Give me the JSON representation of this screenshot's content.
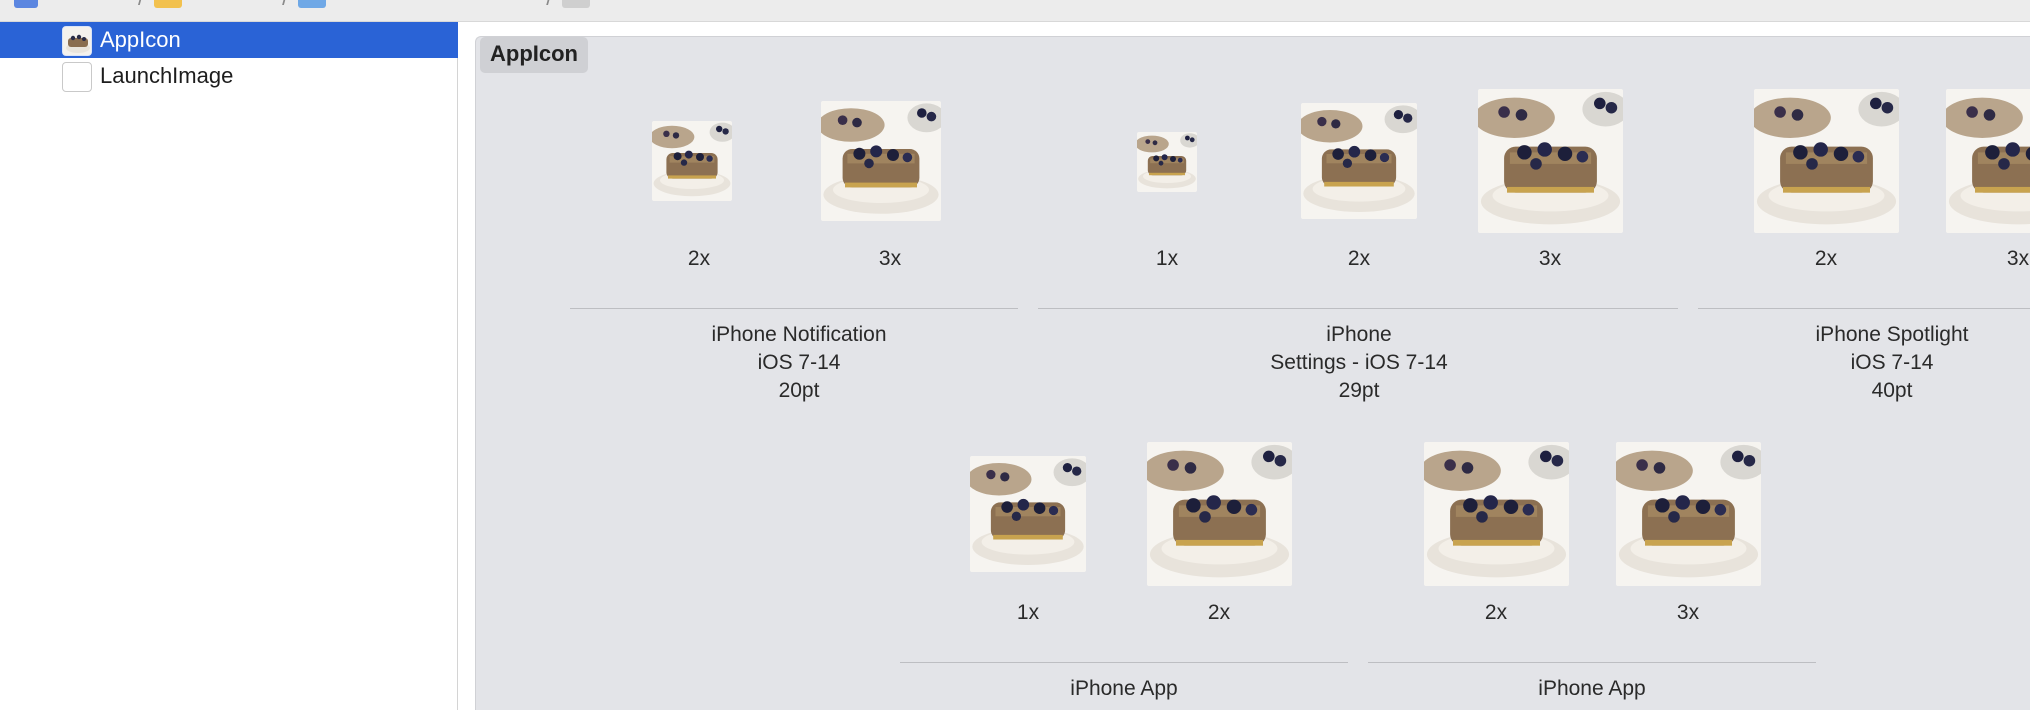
{
  "sidebar": {
    "items": [
      {
        "label": "AppIcon",
        "selected": true
      },
      {
        "label": "LaunchImage",
        "selected": false
      }
    ]
  },
  "editor": {
    "set_title": "AppIcon",
    "groups": [
      {
        "slots": [
          "2x",
          "3x"
        ],
        "lines": [
          "iPhone Notification",
          "iOS 7-14",
          "20pt"
        ]
      },
      {
        "slots": [
          "1x",
          "2x",
          "3x"
        ],
        "lines": [
          "iPhone",
          "Settings - iOS 7-14",
          "29pt"
        ]
      },
      {
        "slots": [
          "2x",
          "3x"
        ],
        "lines": [
          "iPhone Spotlight",
          "iOS 7-14",
          "40pt"
        ]
      },
      {
        "slots": [
          "1x",
          "2x"
        ],
        "lines": [
          "iPhone App"
        ]
      },
      {
        "slots": [
          "2x",
          "3x"
        ],
        "lines": [
          "iPhone App"
        ]
      }
    ]
  },
  "colors": {
    "selection": "#2a63d6",
    "canvas": "#e3e4e8",
    "title_pill": "#cfd0d4"
  }
}
